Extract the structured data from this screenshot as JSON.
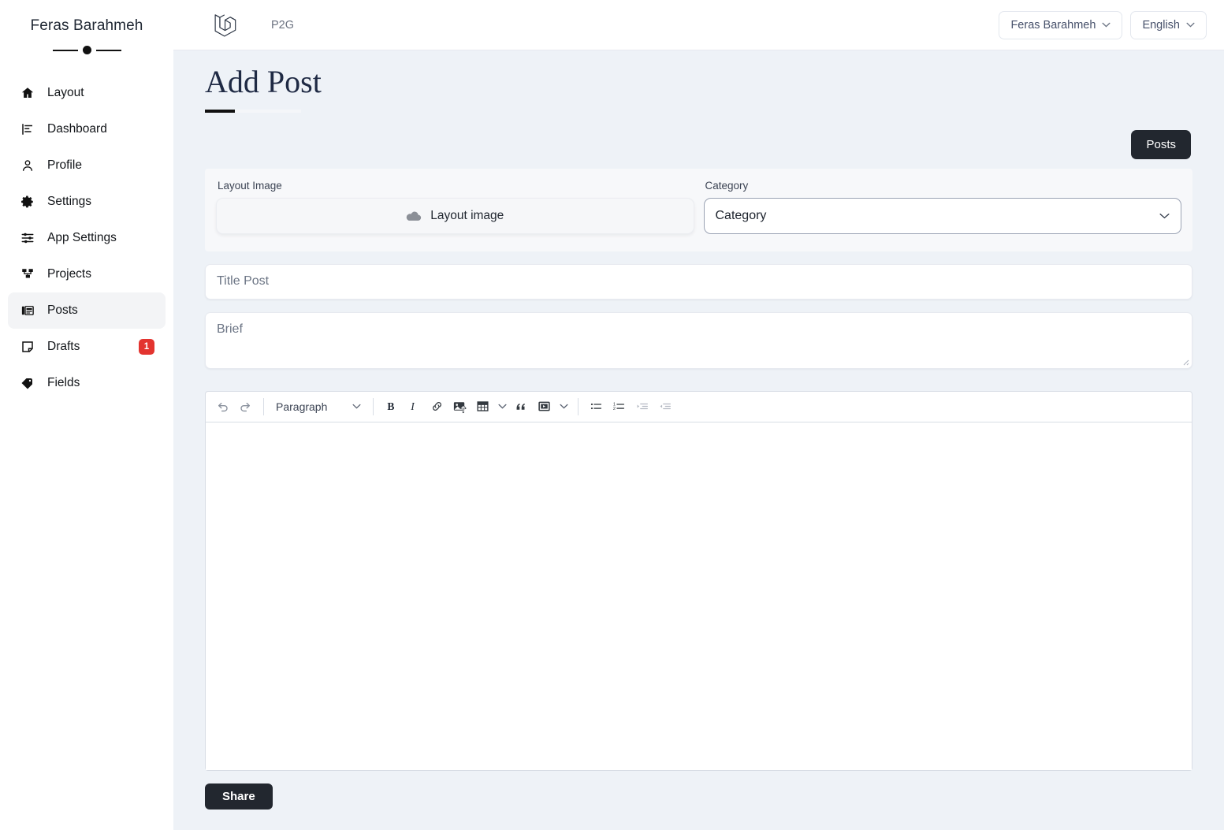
{
  "sidebar": {
    "user_name": "Feras Barahmeh",
    "items": [
      {
        "label": "Layout",
        "icon": "home-icon",
        "active": false,
        "badge": null
      },
      {
        "label": "Dashboard",
        "icon": "chart-bar-icon",
        "active": false,
        "badge": null
      },
      {
        "label": "Profile",
        "icon": "user-icon",
        "active": false,
        "badge": null
      },
      {
        "label": "Settings",
        "icon": "gear-icon",
        "active": false,
        "badge": null
      },
      {
        "label": "App Settings",
        "icon": "sliders-icon",
        "active": false,
        "badge": null
      },
      {
        "label": "Projects",
        "icon": "diagram-icon",
        "active": false,
        "badge": null
      },
      {
        "label": "Posts",
        "icon": "posts-icon",
        "active": true,
        "badge": null
      },
      {
        "label": "Drafts",
        "icon": "note-icon",
        "active": false,
        "badge": "1"
      },
      {
        "label": "Fields",
        "icon": "tag-icon",
        "active": false,
        "badge": null
      }
    ]
  },
  "topbar": {
    "logo": "laravel-logo",
    "brand_name": "P2G",
    "user_menu_label": "Feras Barahmeh",
    "language_menu_label": "English"
  },
  "page": {
    "title": "Add Post",
    "posts_button_label": "Posts"
  },
  "form": {
    "layout_image_label": "Layout Image",
    "layout_image_dropzone_text": "Layout image",
    "layout_image_icon": "cloud-upload-icon",
    "category_label": "Category",
    "category_value": "Category",
    "title_placeholder": "Title Post",
    "brief_placeholder": "Brief"
  },
  "editor": {
    "block_format_label": "Paragraph",
    "toolbar": [
      {
        "name": "undo-icon",
        "kind": "icon"
      },
      {
        "name": "redo-icon",
        "kind": "icon"
      },
      {
        "name": "toolbar-separator",
        "kind": "sep"
      },
      {
        "name": "block-format-select",
        "kind": "select"
      },
      {
        "name": "toolbar-separator",
        "kind": "sep"
      },
      {
        "name": "bold-icon",
        "kind": "icon"
      },
      {
        "name": "italic-icon",
        "kind": "icon"
      },
      {
        "name": "link-icon",
        "kind": "icon"
      },
      {
        "name": "image-upload-icon",
        "kind": "icon"
      },
      {
        "name": "table-icon",
        "kind": "icon"
      },
      {
        "name": "table-chevron-down-icon",
        "kind": "chev"
      },
      {
        "name": "blockquote-icon",
        "kind": "icon"
      },
      {
        "name": "media-icon",
        "kind": "icon"
      },
      {
        "name": "media-chevron-down-icon",
        "kind": "chev"
      },
      {
        "name": "toolbar-separator",
        "kind": "sep"
      },
      {
        "name": "bullet-list-icon",
        "kind": "icon"
      },
      {
        "name": "numbered-list-icon",
        "kind": "icon"
      },
      {
        "name": "outdent-icon",
        "kind": "icon"
      },
      {
        "name": "indent-icon",
        "kind": "icon"
      }
    ],
    "content": ""
  },
  "actions": {
    "share_label": "Share"
  },
  "colors": {
    "page_background": "#eef2f7",
    "surface": "#ffffff",
    "dark_button": "#22272f",
    "badge_red": "#e3342f",
    "muted_text": "#6b7484"
  }
}
